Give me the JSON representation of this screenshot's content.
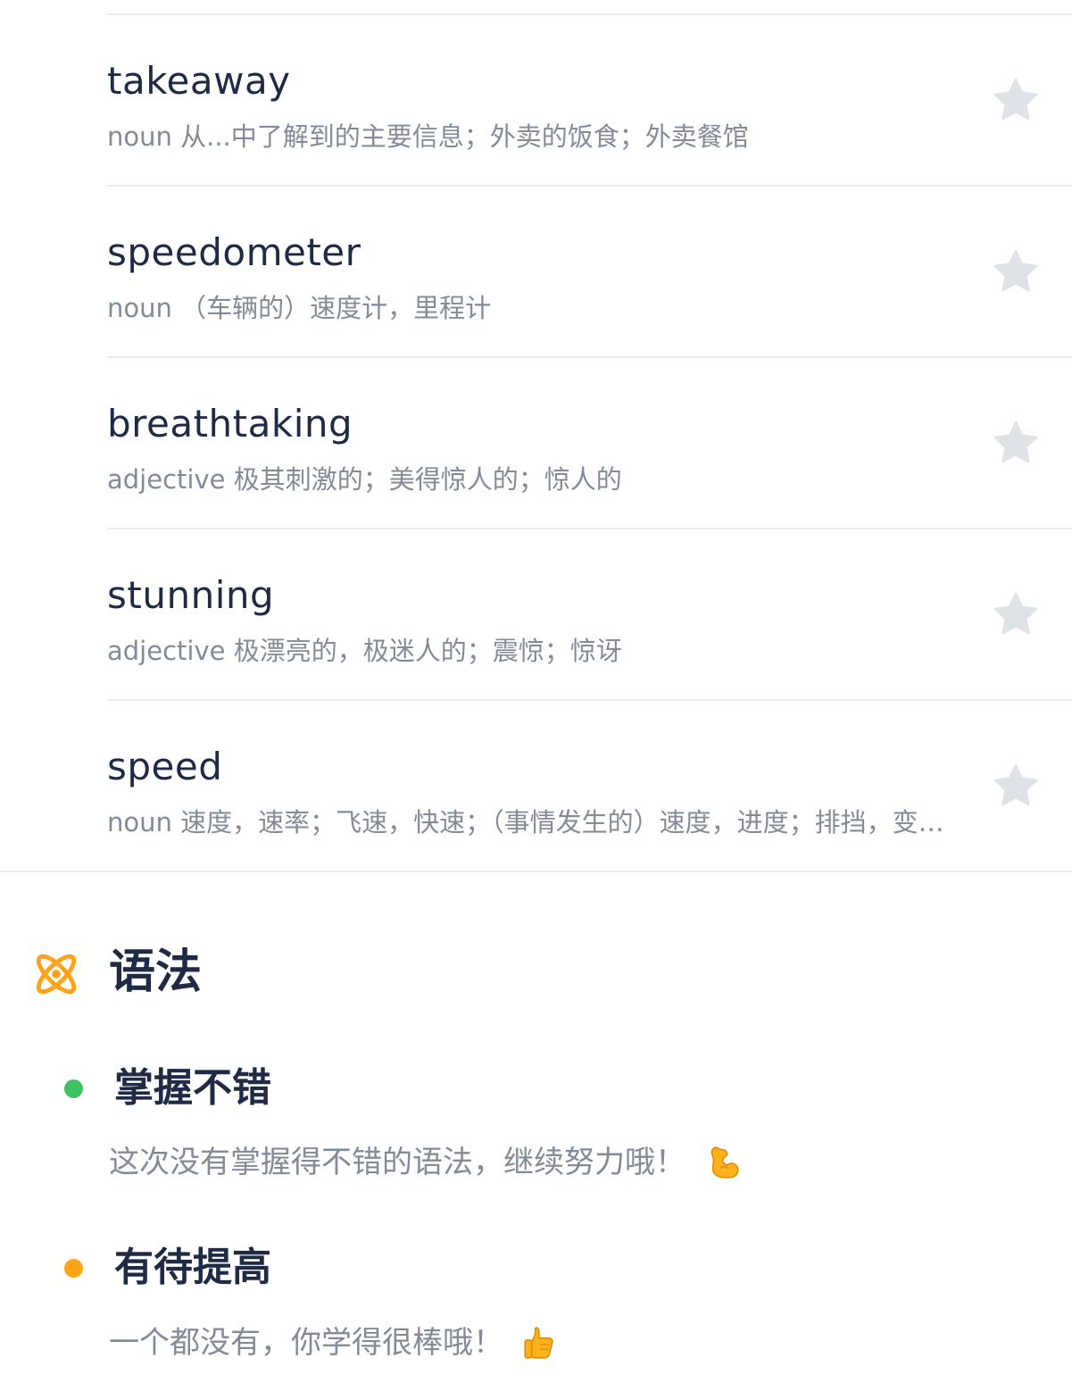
{
  "word_list": [
    {
      "word": "takeaway",
      "pos": "noun",
      "definition": "从...中了解到的主要信息；外卖的饭食；外卖餐馆"
    },
    {
      "word": "speedometer",
      "pos": "noun",
      "definition": "（车辆的）速度计，里程计"
    },
    {
      "word": "breathtaking",
      "pos": "adjective",
      "definition": "极其刺激的；美得惊人的；惊人的"
    },
    {
      "word": "stunning",
      "pos": "adjective",
      "definition": "极漂亮的，极迷人的；震惊；惊讶"
    },
    {
      "word": "speed",
      "pos": "noun",
      "definition": "速度，速率；飞速，快速；（事情发生的）速度，进度；排挡，变…"
    }
  ],
  "grammar": {
    "title": "语法",
    "icon": "atom-flower-icon",
    "accent_color": "#ffa31a",
    "sections": [
      {
        "title": "掌握不错",
        "status_color": "#3dc35f",
        "message": "这次没有掌握得不错的语法，继续努力哦！",
        "emoji": "flexed-biceps-icon"
      },
      {
        "title": "有待提高",
        "status_color": "#ffa31a",
        "message": "一个都没有，你学得很棒哦！",
        "emoji": "thumbs-up-icon"
      }
    ]
  },
  "colors": {
    "text_primary": "#1f2a44",
    "text_secondary": "#838b98",
    "divider": "#e8ebf0",
    "star": "#dfe2e7"
  }
}
